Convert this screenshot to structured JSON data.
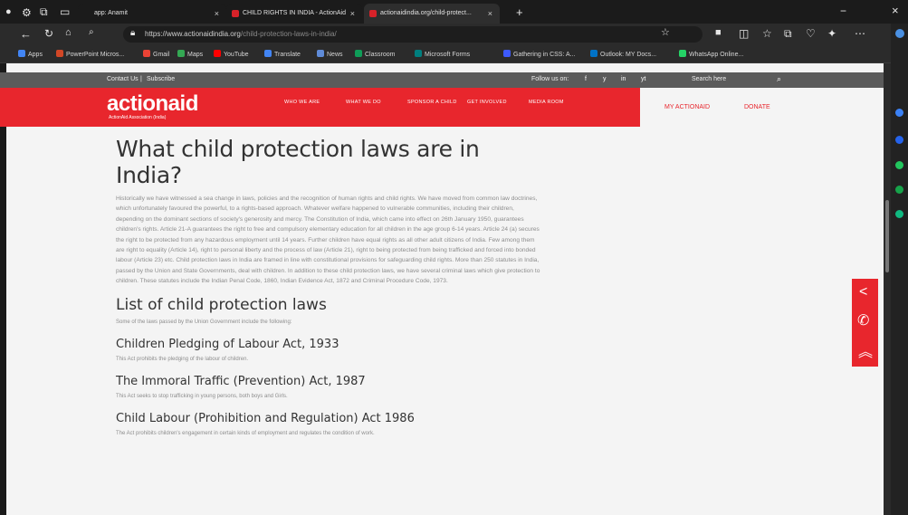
{
  "browser": {
    "tabs": [
      {
        "label": "app: Anamit"
      },
      {
        "label": "CHILD RIGHTS IN INDIA - ActionAid",
        "favicon_color": "#d72229"
      },
      {
        "label": "actionaidindia.org/child-protect..."
      }
    ],
    "new_tab": "+",
    "url_domain": "https://www.actionaidindia.org",
    "url_path": "/child-protection-laws-in-india/",
    "window_minimize": "−",
    "window_close": "×",
    "bookmarks": [
      {
        "label": "Apps",
        "color": "#4285f4"
      },
      {
        "label": "PowerPoint Micros...",
        "color": "#d24726"
      },
      {
        "label": "Gmail",
        "color": "#ea4335"
      },
      {
        "label": "Maps",
        "color": "#34a853"
      },
      {
        "label": "YouTube",
        "color": "#ff0000"
      },
      {
        "label": "Translate",
        "color": "#4285f4"
      },
      {
        "label": "News",
        "color": "#5f8bd8"
      },
      {
        "label": "Classroom",
        "color": "#0f9d58"
      },
      {
        "label": "Microsoft Forms",
        "color": "#007f7f"
      },
      {
        "label": "Gathering in CSS: A...",
        "color": "#3d5afe"
      },
      {
        "label": "Outlook: MY Docs...",
        "color": "#0072c6"
      },
      {
        "label": "WhatsApp Online...",
        "color": "#25d366"
      }
    ]
  },
  "site": {
    "topbar": {
      "contact": "Contact Us",
      "separator": "|",
      "subscribe": "Subscribe",
      "follow": "Follow us on:",
      "social": [
        "f",
        "y",
        "in",
        "yt"
      ],
      "search_placeholder": "Search here"
    },
    "logo": {
      "main": "actionaid",
      "tagline": "ActionAid Association (India)"
    },
    "nav": [
      {
        "label": "WHO WE ARE"
      },
      {
        "label": "WHAT WE DO"
      },
      {
        "label": "SPONSOR A CHILD"
      },
      {
        "label": "GET INVOLVED"
      },
      {
        "label": "MEDIA ROOM"
      }
    ],
    "nav_right": {
      "my_actionaid": "MY ACTIONAID",
      "donate": "DONATE"
    }
  },
  "article": {
    "title": "What child protection laws are in India?",
    "paragraph": "Historically we have witnessed a sea change in laws, policies and the recognition of human rights and child rights. We have moved from common law doctrines, which unfortunately favoured the powerful, to a rights-based approach. Whatever welfare happened to vulnerable communities, including their children, depending on the dominant sections of society's generosity and mercy. The Constitution of India, which came into effect on 26th January 1950, guarantees children's rights. Article 21-A guarantees the right to free and compulsory elementary education for all children in the age group 6-14 years. Article 24 (a) secures the right to be protected from any hazardous employment until 14 years. Further children have equal rights as all other adult citizens of India. Few among them are right to equality (Article 14), right to personal liberty and the process of law (Article 21), right to being protected from being trafficked and forced into bonded labour (Article 23) etc. Child protection laws in India are framed in line with constitutional provisions for safeguarding child rights. More than 250 statutes in India, passed by the Union and State Governments, deal with children. In addition to these child protection laws, we have several criminal laws which give protection to children. These statutes include the Indian Penal Code, 1860, Indian Evidence Act, 1872 and Criminal Procedure Code, 1973.",
    "list_heading": "List of child protection laws",
    "list_intro": "Some of the laws passed by the Union Government include the following:",
    "laws": [
      {
        "title": "Children Pledging of Labour Act, 1933",
        "desc": "This Act prohibits the pledging of the labour of children."
      },
      {
        "title": "The Immoral Traffic (Prevention) Act, 1987",
        "desc": "This Act seeks to stop trafficking in young persons, both boys and Girls."
      },
      {
        "title": "Child Labour (Prohibition and Regulation) Act 1986",
        "desc": "The Act prohibits children's engagement in certain kinds of employment and regulates the condition of work."
      }
    ]
  }
}
